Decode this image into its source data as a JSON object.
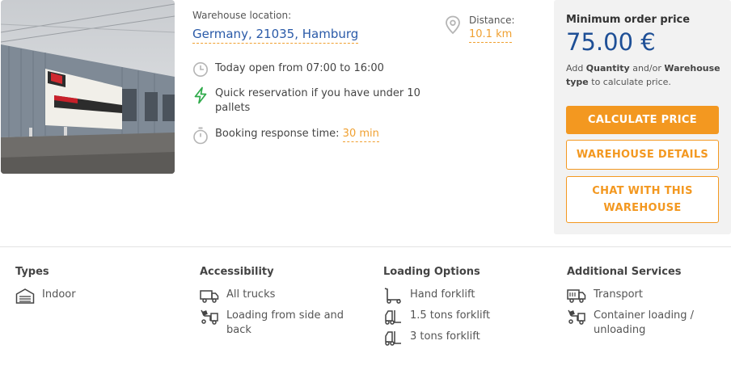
{
  "location": {
    "label": "Warehouse location:",
    "address": "Germany, 21035, Hamburg"
  },
  "distance": {
    "label": "Distance:",
    "value": "10.1 km"
  },
  "info": {
    "open": "Today open from 07:00 to 16:00",
    "quick": "Quick reservation if you have under 10 pallets",
    "booking_label": "Booking response time:",
    "booking_value": "30 min"
  },
  "pricing": {
    "title": "Minimum order price",
    "value": "75.00 €",
    "note_add": "Add ",
    "note_quantity": "Quantity",
    "note_andor": " and/or ",
    "note_warehouse": "Warehouse type",
    "note_rest": " to calculate price.",
    "calculate_label": "CALCULATE PRICE",
    "details_label": "WAREHOUSE DETAILS",
    "chat_label": "CHAT WITH THIS WAREHOUSE"
  },
  "features": {
    "types": {
      "title": "Types",
      "items": [
        "Indoor"
      ]
    },
    "accessibility": {
      "title": "Accessibility",
      "items": [
        "All trucks",
        "Loading from side and back"
      ]
    },
    "loading": {
      "title": "Loading Options",
      "items": [
        "Hand forklift",
        "1.5 tons forklift",
        "3 tons forklift"
      ]
    },
    "services": {
      "title": "Additional Services",
      "items": [
        "Transport",
        "Container loading / unloading"
      ]
    }
  },
  "colors": {
    "accent": "#f39820",
    "link": "#2a5aa8",
    "price": "#1e4f96",
    "bolt": "#2eaa4a"
  }
}
